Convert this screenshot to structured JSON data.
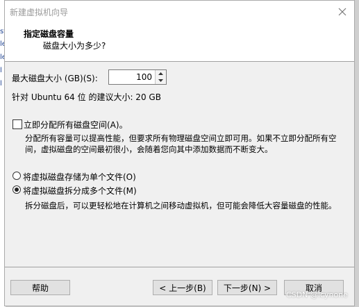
{
  "background_snippets": [
    "st",
    "le",
    "le",
    "l",
    "l"
  ],
  "window": {
    "title": "新建虚拟机向导",
    "close_icon": "close-icon"
  },
  "header": {
    "title": "指定磁盘容量",
    "subtitle": "磁盘大小为多少?"
  },
  "disk_size": {
    "label": "最大磁盘大小 (GB)(S):",
    "value": "100",
    "recommendation": "针对 Ubuntu 64 位 的建议大小: 20 GB"
  },
  "allocate": {
    "label": "立即分配所有磁盘空间(A)。",
    "checked": false,
    "description": "分配所有容量可以提高性能，但要求所有物理磁盘空间立即可用。如果不立即分配所有空间，虚拟磁盘的空间最初很小，会随着您向其中添加数据而不断变大。"
  },
  "storage_options": [
    {
      "label": "将虚拟磁盘存储为单个文件(O)",
      "checked": false
    },
    {
      "label": "将虚拟磁盘拆分成多个文件(M)",
      "checked": true
    }
  ],
  "split_description": "拆分磁盘后，可以更轻松地在计算机之间移动虚拟机，但可能会降低大容量磁盘的性能。",
  "buttons": {
    "help": "帮助",
    "back": "< 上一步(B)",
    "next": "下一步(N) >",
    "cancel": "取消"
  },
  "watermark": "CSDN @lcynone"
}
